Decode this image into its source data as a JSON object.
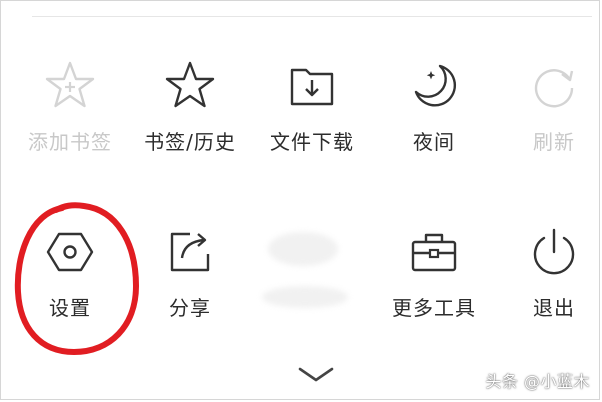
{
  "colors": {
    "icon_active": "#333333",
    "icon_disabled": "#d4d4d4",
    "annotation": "#e11d22"
  },
  "menu": {
    "row1": [
      {
        "key": "add_bookmark",
        "label": "添加书签",
        "icon": "star-plus-icon",
        "disabled": true
      },
      {
        "key": "bookmarks_history",
        "label": "书签/历史",
        "icon": "star-icon",
        "disabled": false
      },
      {
        "key": "downloads",
        "label": "文件下载",
        "icon": "download-folder-icon",
        "disabled": false
      },
      {
        "key": "night_mode",
        "label": "夜间",
        "icon": "moon-icon",
        "disabled": false
      },
      {
        "key": "refresh",
        "label": "刷新",
        "icon": "refresh-icon",
        "disabled": true
      }
    ],
    "row2": [
      {
        "key": "settings",
        "label": "设置",
        "icon": "hexagon-settings-icon",
        "disabled": false
      },
      {
        "key": "share",
        "label": "分享",
        "icon": "share-icon",
        "disabled": false
      },
      {
        "key": "more_tools",
        "label": "更多工具",
        "icon": "toolbox-icon",
        "disabled": false
      },
      {
        "key": "exit",
        "label": "退出",
        "icon": "power-icon",
        "disabled": false
      }
    ]
  },
  "footer": {
    "collapse_icon": "chevron-down-icon",
    "watermark": "头条 @小蓝木"
  }
}
